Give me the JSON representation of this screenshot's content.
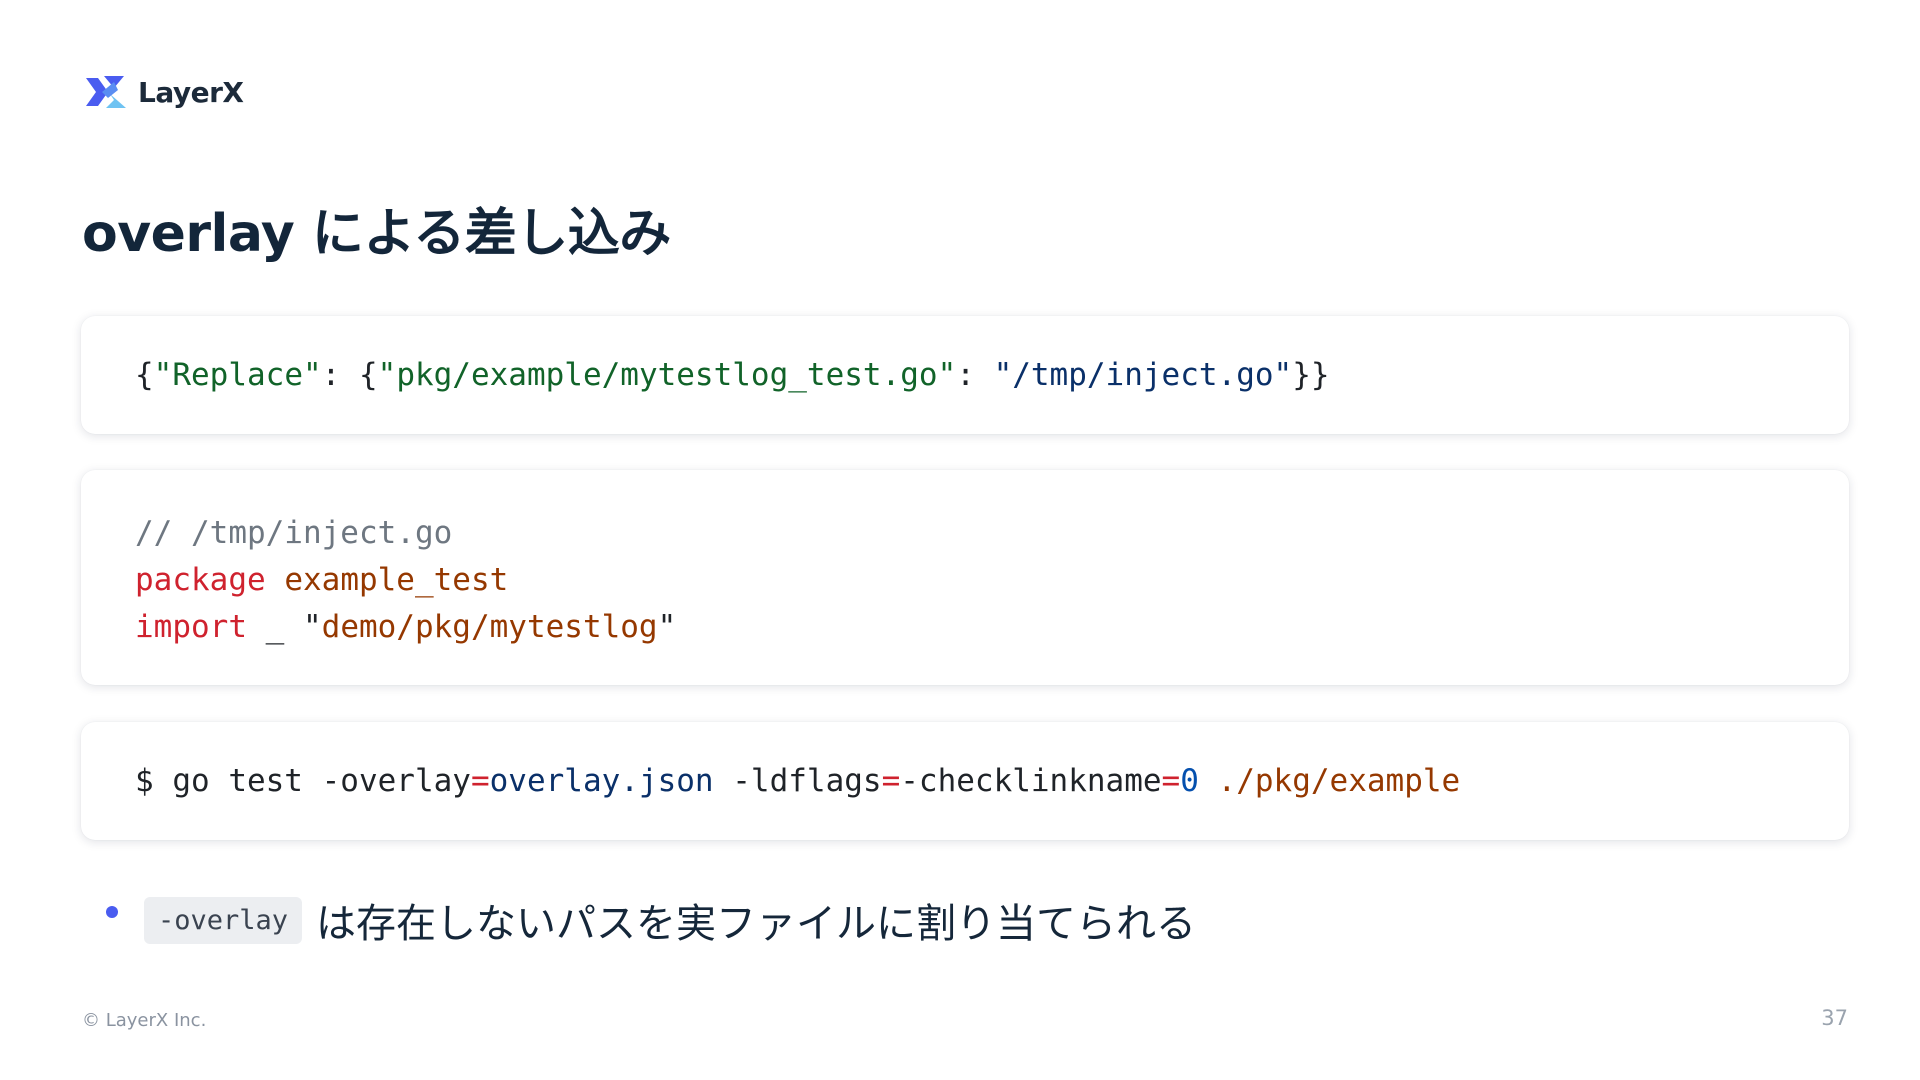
{
  "brand": {
    "logo_icon": "layerx-logo-icon",
    "logo_text": "LayerX",
    "colors": {
      "logo_primary": "#4a5cf0",
      "logo_secondary": "#6fc3f2"
    }
  },
  "slide": {
    "title": "overlay による差し込み",
    "page_number": "37",
    "copyright": "© LayerX Inc."
  },
  "code_blocks": {
    "overlay_json": {
      "p1": "{",
      "k1": "\"Replace\"",
      "p2": ": {",
      "k2": "\"pkg/example/mytestlog_test.go\"",
      "p3": ": ",
      "v1": "\"/tmp/inject.go\"",
      "p4": "}}"
    },
    "inject_go": {
      "comment": "// /tmp/inject.go",
      "kw_package": "package",
      "pkg_name": "example_test",
      "kw_import": "import",
      "blank": " _ ",
      "q_open": "\"",
      "import_path": "demo/pkg/mytestlog",
      "q_close": "\""
    },
    "command": {
      "prompt_cmd": "$ go test -overlay",
      "eq1": "=",
      "overlay_val": "overlay.json",
      "ldflags": " -ldflags",
      "eq2": "=",
      "checklinkname": "-checklinkname",
      "eq3": "=",
      "zero": "0",
      "target": " ./pkg/example"
    }
  },
  "bullets": [
    {
      "code": "-overlay",
      "text": "は存在しないパスを実ファイルに割り当てられる"
    }
  ],
  "syntax_colors": {
    "keyword": "#cf222e",
    "string": "#0a3069",
    "json_key": "#116329",
    "comment": "#6e7781",
    "identifier": "#953800",
    "bullet": "#4a5cf0"
  }
}
